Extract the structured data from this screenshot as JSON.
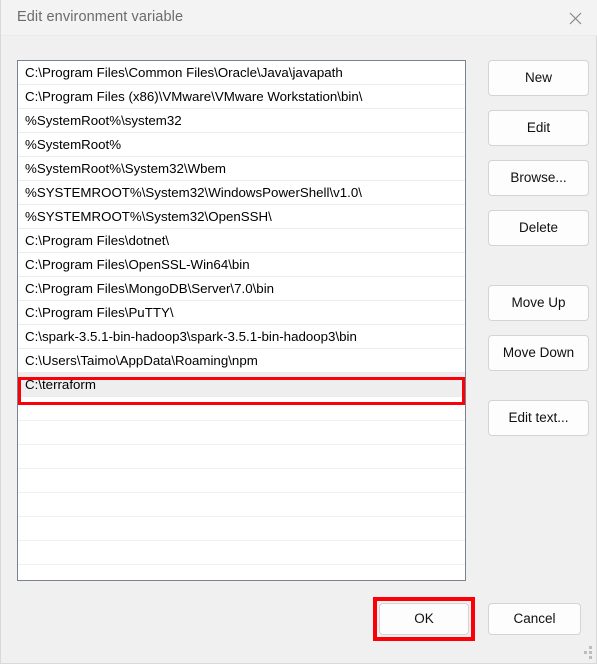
{
  "window": {
    "title": "Edit environment variable",
    "close_icon": "close-icon",
    "resize_grip": "resize-grip"
  },
  "list": {
    "entries": [
      "C:\\Program Files\\Common Files\\Oracle\\Java\\javapath",
      "C:\\Program Files (x86)\\VMware\\VMware Workstation\\bin\\",
      "%SystemRoot%\\system32",
      "%SystemRoot%",
      "%SystemRoot%\\System32\\Wbem",
      "%SYSTEMROOT%\\System32\\WindowsPowerShell\\v1.0\\",
      "%SYSTEMROOT%\\System32\\OpenSSH\\",
      "C:\\Program Files\\dotnet\\",
      "C:\\Program Files\\OpenSSL-Win64\\bin",
      "C:\\Program Files\\MongoDB\\Server\\7.0\\bin",
      "C:\\Program Files\\PuTTY\\",
      "C:\\spark-3.5.1-bin-hadoop3\\spark-3.5.1-bin-hadoop3\\bin",
      "C:\\Users\\Taimo\\AppData\\Roaming\\npm",
      "C:\\terraform"
    ],
    "selected_index": 13,
    "empty_rows": 7
  },
  "side_buttons": [
    {
      "label": "New"
    },
    {
      "label": "Edit"
    },
    {
      "label": "Browse..."
    },
    {
      "label": "Delete"
    },
    {
      "label": "Move Up"
    },
    {
      "label": "Move Down"
    },
    {
      "label": "Edit text..."
    }
  ],
  "footer": {
    "ok_label": "OK",
    "cancel_label": "Cancel"
  },
  "colors": {
    "annotation": "#fb0007",
    "titlebar": "#f3f3f3",
    "dialog_bg": "#f0f0f0",
    "list_bg": "#ffffff",
    "selected_row": "#eeeeee"
  }
}
